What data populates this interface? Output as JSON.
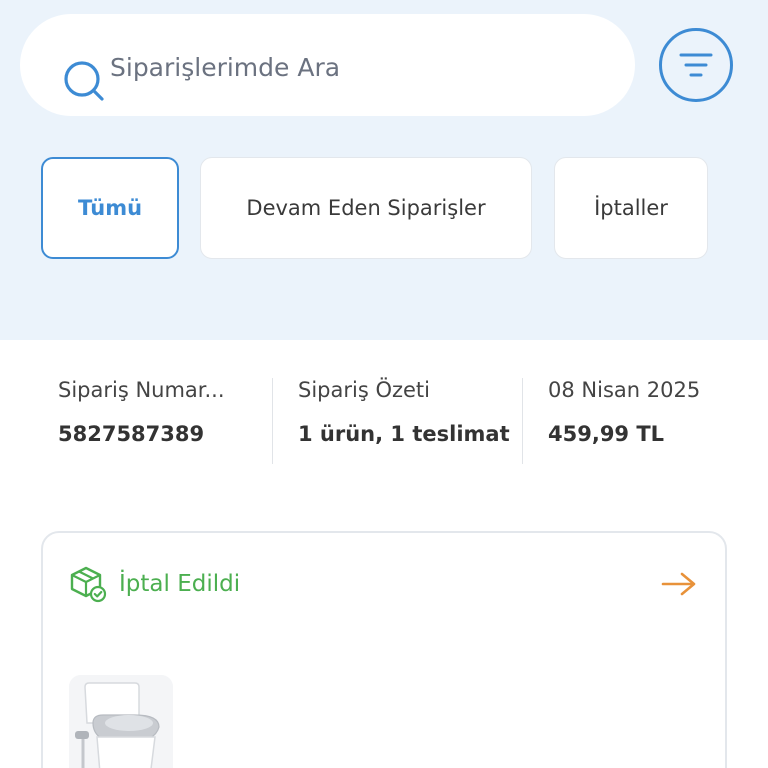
{
  "search": {
    "placeholder": "Siparişlerimde Ara"
  },
  "tabs": [
    {
      "label": "Tümü",
      "active": true
    },
    {
      "label": "Devam Eden Siparişler",
      "active": false
    },
    {
      "label": "İptaller",
      "active": false
    }
  ],
  "order": {
    "number_label": "Sipariş Numar...",
    "number_value": "5827587389",
    "summary_label": "Sipariş Özeti",
    "summary_value": "1 ürün, 1 teslimat",
    "date": "08 Nisan 2025",
    "total": "459,99 TL"
  },
  "card": {
    "status": "İptal Edildi",
    "status_icon": "package-check-icon",
    "detail_icon": "arrow-right-icon",
    "product_image": "baby-potty-product-image"
  },
  "colors": {
    "accent": "#3d8bd4",
    "status_cancelled": "#4caf50",
    "arrow": "#e8923a",
    "top_background": "#ebf3fb"
  }
}
